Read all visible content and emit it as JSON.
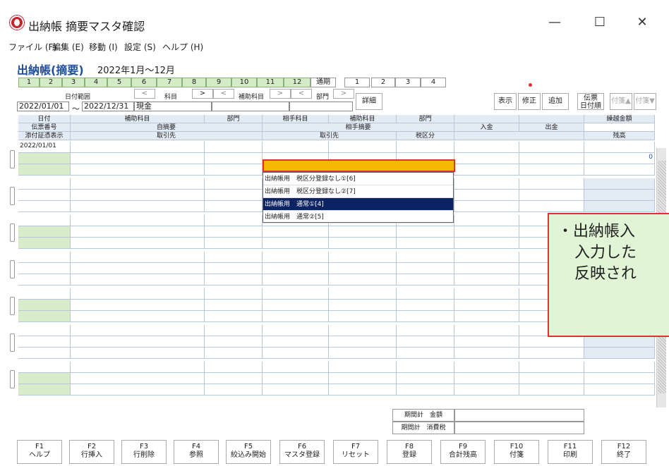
{
  "window": {
    "title": "出納帳 摘要マスタ確認",
    "minimize": "—",
    "maximize": "☐",
    "close": "✕"
  },
  "menu": [
    "ファイル (F)",
    "編集 (E)",
    "移動 (I)",
    "設定 (S)",
    "ヘルプ (H)"
  ],
  "headline": "出納帳(摘要)",
  "period": "2022年1月～12月",
  "month_tabs": [
    "1",
    "2",
    "3",
    "4",
    "5",
    "6",
    "7",
    "8",
    "9",
    "10",
    "11",
    "12",
    "通期",
    "1",
    "2",
    "3",
    "4"
  ],
  "filters": {
    "date_range_label": "日付範囲",
    "account_label": "科目",
    "sub_account_label": "補助科目",
    "dept_label": "部門",
    "date_from": "2022/01/01",
    "date_tilde": "～",
    "date_to": "2022/12/31",
    "account_value": "現金",
    "nav_prev": "<",
    "nav_next": ">",
    "detail": "詳細"
  },
  "actions": {
    "show": "表示",
    "edit": "修正",
    "add": "追加",
    "slip_date_1": "伝票",
    "slip_date_2": "日付順",
    "tag_up": "付箋▲",
    "tag_down": "付箋▼"
  },
  "columns": {
    "row1": [
      "日付",
      "補助科目",
      "部門",
      "相手科目",
      "補助科目",
      "部門",
      "繰越金額"
    ],
    "row2": [
      "伝票番号",
      "自摘要",
      "相手摘要",
      "入金",
      "出金"
    ],
    "row3": [
      "添付証憑表示",
      "取引先",
      "取引先",
      "税区分",
      "残高"
    ]
  },
  "first_row": {
    "date": "2022/01/01",
    "balance": "0"
  },
  "dropdown": {
    "items": [
      "出納帳用　税区分登録なし①[6]",
      "出納帳用　税区分登録なし②[7]",
      "出納帳用　通常①[4]",
      "出納帳用　通常②[5]"
    ],
    "selected": 2
  },
  "callout": {
    "line1": "・出納帳入",
    "line2": "入力した",
    "line3": "反映され"
  },
  "totals": {
    "amount": "期間計　金額",
    "tax": "期間計　消費税"
  },
  "fkeys": [
    {
      "key": "F1",
      "label": "ヘルプ"
    },
    {
      "key": "F2",
      "label": "行挿入"
    },
    {
      "key": "F3",
      "label": "行削除"
    },
    {
      "key": "F4",
      "label": "参照"
    },
    {
      "key": "F5",
      "label": "絞込み開始"
    },
    {
      "key": "F6",
      "label": "マスタ登録"
    },
    {
      "key": "F7",
      "label": "リセット"
    },
    {
      "key": "F8",
      "label": "登録"
    },
    {
      "key": "F9",
      "label": "合計残高"
    },
    {
      "key": "F10",
      "label": "付箋"
    },
    {
      "key": "F11",
      "label": "印刷"
    },
    {
      "key": "F12",
      "label": "終了"
    }
  ],
  "colors": {
    "accent": "#1f4f9c",
    "highlight": "#f5b800",
    "alert": "#e13030",
    "selected": "#0a2463"
  }
}
